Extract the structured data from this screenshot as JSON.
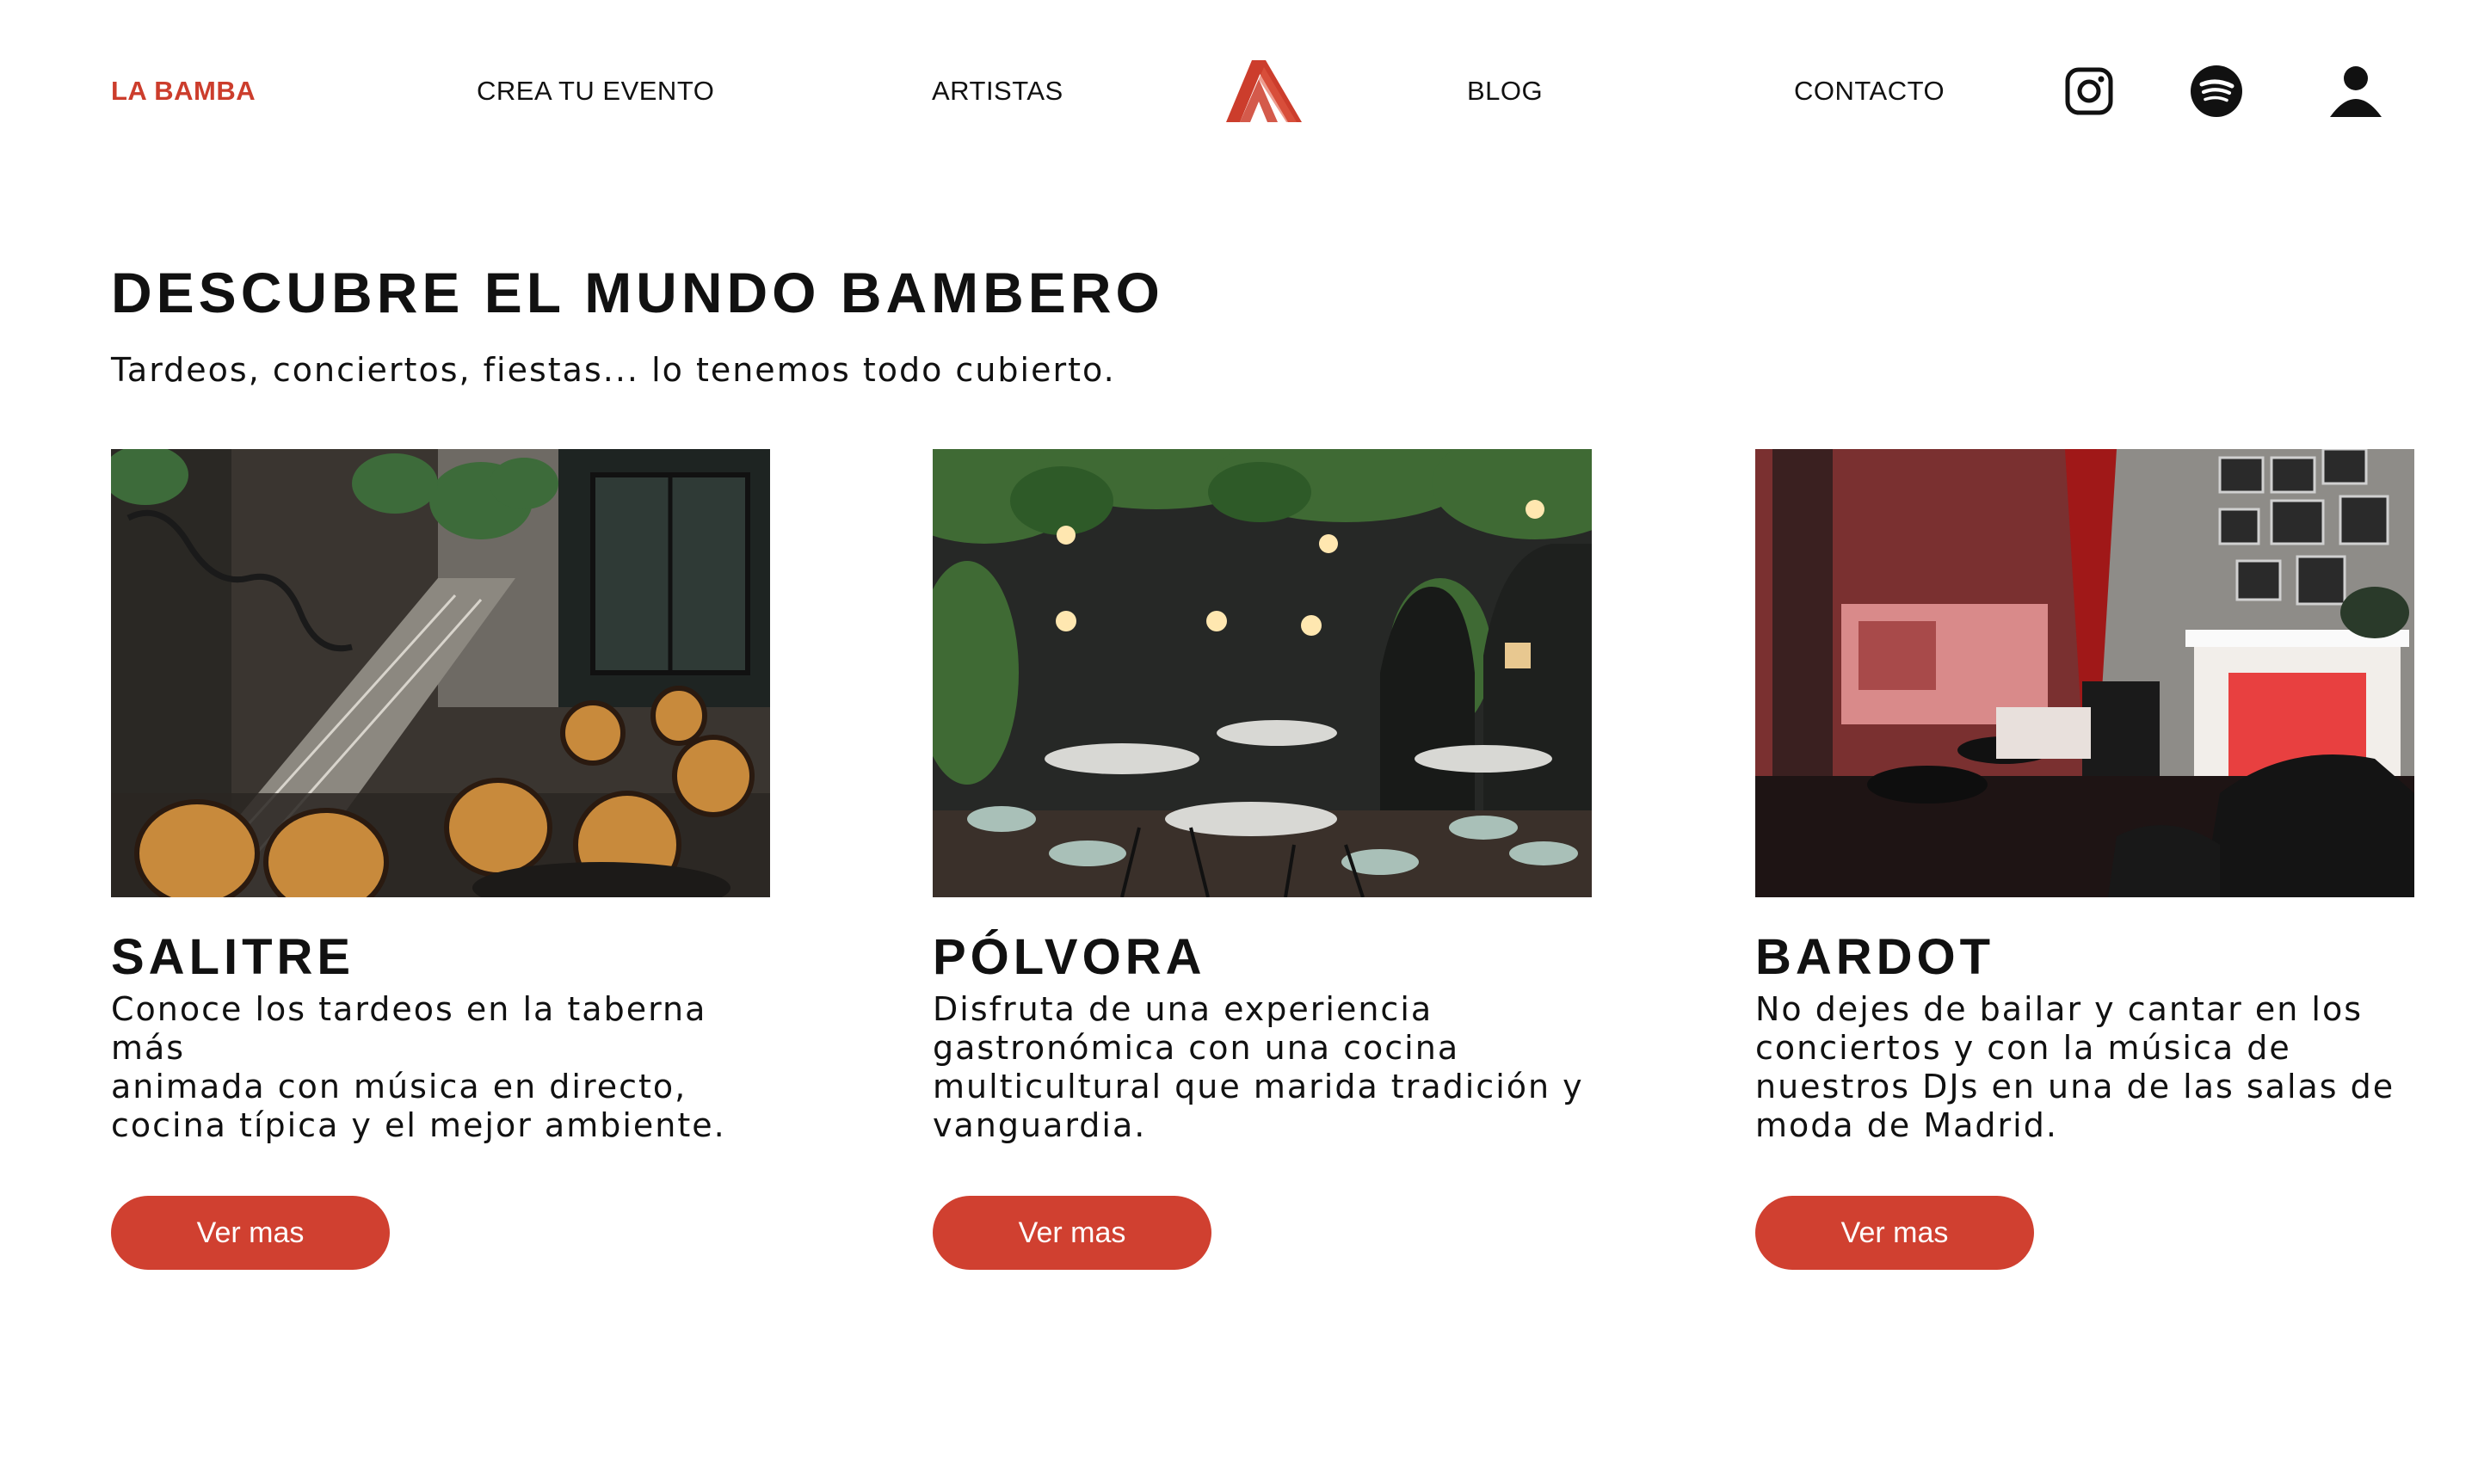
{
  "colors": {
    "accent": "#cc3d2c",
    "button": "#d04030",
    "text": "#111111",
    "background": "#ffffff"
  },
  "nav": {
    "items": [
      {
        "label": "LA BAMBA",
        "active": true
      },
      {
        "label": "CREA TU EVENTO",
        "active": false
      },
      {
        "label": "ARTISTAS",
        "active": false
      },
      {
        "label": "BLOG",
        "active": false
      },
      {
        "label": "CONTACTO",
        "active": false
      }
    ],
    "logo": "la-bamba-logo",
    "icons": [
      "instagram-icon",
      "spotify-icon",
      "user-icon"
    ]
  },
  "hero": {
    "title": "DESCUBRE EL MUNDO BAMBERO",
    "subtitle": "Tardeos, conciertos, fiestas... lo tenemos todo cubierto."
  },
  "cards": [
    {
      "title": "SALITRE",
      "lines": [
        "Conoce los tardeos en la taberna más",
        "animada con música en directo,",
        "cocina típica y el mejor ambiente."
      ],
      "button": "Ver mas",
      "image": "salitre-photo"
    },
    {
      "title": "PÓLVORA",
      "lines": [
        "Disfruta de una experiencia",
        "gastronómica con una cocina",
        "multicultural que marida tradición y",
        "vanguardia."
      ],
      "button": "Ver mas",
      "image": "polvora-photo"
    },
    {
      "title": "BARDOT",
      "lines": [
        "No dejes de bailar y cantar en los",
        "conciertos y con la música de",
        "nuestros DJs en una de las salas de",
        "moda de Madrid."
      ],
      "button": "Ver mas",
      "image": "bardot-photo"
    }
  ]
}
